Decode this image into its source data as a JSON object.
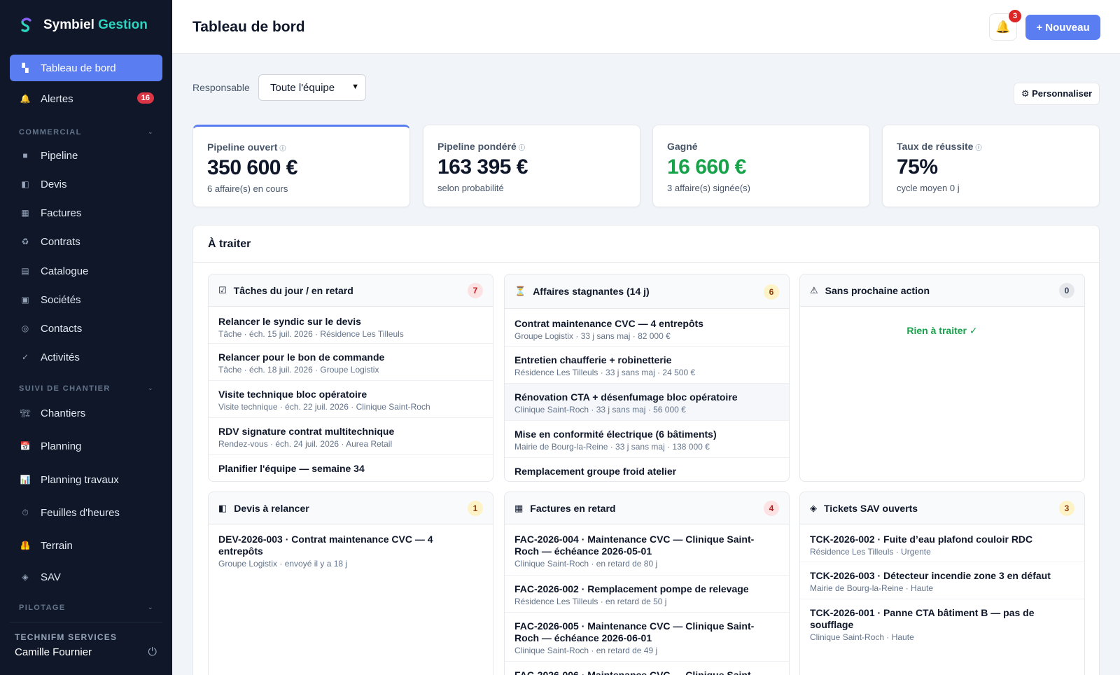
{
  "brand": {
    "name_main": "Symbiel",
    "name_accent": "Gestion"
  },
  "sidebar": {
    "top": [
      {
        "label": "Tableau de bord",
        "icon": "▚"
      },
      {
        "label": "Alertes",
        "icon": "🔔",
        "badge": "16"
      }
    ],
    "sections": [
      {
        "title": "COMMERCIAL",
        "items": [
          {
            "label": "Pipeline",
            "icon": "■"
          },
          {
            "label": "Devis",
            "icon": "◧"
          },
          {
            "label": "Factures",
            "icon": "▦"
          },
          {
            "label": "Contrats",
            "icon": "♻"
          },
          {
            "label": "Catalogue",
            "icon": "▤"
          },
          {
            "label": "Sociétés",
            "icon": "▣"
          },
          {
            "label": "Contacts",
            "icon": "◎"
          },
          {
            "label": "Activités",
            "icon": "✓"
          }
        ]
      },
      {
        "title": "SUIVI DE CHANTIER",
        "items": [
          {
            "label": "Chantiers",
            "icon": "🏗"
          },
          {
            "label": "Planning",
            "icon": "📅"
          },
          {
            "label": "Planning travaux",
            "icon": "📊"
          },
          {
            "label": "Feuilles d'heures",
            "icon": "⏱"
          },
          {
            "label": "Terrain",
            "icon": "🦺"
          },
          {
            "label": "SAV",
            "icon": "◈"
          }
        ]
      },
      {
        "title": "PILOTAGE",
        "items": []
      }
    ],
    "footer": {
      "org": "TECHNIFM SERVICES",
      "user": "Camille Fournier"
    }
  },
  "header": {
    "title": "Tableau de bord",
    "notif_count": "3",
    "new_label": "+ Nouveau"
  },
  "filter": {
    "label": "Responsable",
    "selected": "Toute l'équipe",
    "customize_label": "⚙ Personnaliser"
  },
  "kpis": [
    {
      "label": "Pipeline ouvert",
      "value": "350 600 €",
      "sub": "6 affaire(s) en cours",
      "info": "ⓘ"
    },
    {
      "label": "Pipeline pondéré",
      "value": "163 395 €",
      "sub": "selon probabilité",
      "info": "ⓘ"
    },
    {
      "label": "Gagné",
      "value": "16 660 €",
      "sub": "3 affaire(s) signée(s)",
      "info": ""
    },
    {
      "label": "Taux de réussite",
      "value": "75%",
      "sub": "cycle moyen 0 j",
      "info": "ⓘ"
    }
  ],
  "todo": {
    "title": "À traiter",
    "cards": [
      {
        "icon": "☑",
        "title": "Tâches du jour / en retard",
        "count": "7",
        "rows": [
          {
            "t": "Relancer le syndic sur le devis",
            "s": "Tâche · éch. 15 juil. 2026 · Résidence Les Tilleuls"
          },
          {
            "t": "Relancer pour le bon de commande",
            "s": "Tâche · éch. 18 juil. 2026 · Groupe Logistix"
          },
          {
            "t": "Visite technique bloc opératoire",
            "s": "Visite technique · éch. 22 juil. 2026 · Clinique Saint-Roch"
          },
          {
            "t": "RDV signature contrat multitechnique",
            "s": "Rendez-vous · éch. 24 juil. 2026 · Aurea Retail"
          },
          {
            "t": "Planifier l'équipe — semaine 34",
            "s": ""
          }
        ]
      },
      {
        "icon": "⏳",
        "title": "Affaires stagnantes (14 j)",
        "count": "6",
        "rows": [
          {
            "t": "Contrat maintenance CVC — 4 entrepôts",
            "s": "Groupe Logistix · 33 j sans maj · 82 000 €"
          },
          {
            "t": "Entretien chaufferie + robinetterie",
            "s": "Résidence Les Tilleuls · 33 j sans maj · 24 500 €"
          },
          {
            "t": "Rénovation CTA + désenfumage bloc opératoire",
            "s": "Clinique Saint-Roch · 33 j sans maj · 56 000 €"
          },
          {
            "t": "Mise en conformité électrique (6 bâtiments)",
            "s": "Mairie de Bourg-la-Reine · 33 j sans maj · 138 000 €"
          },
          {
            "t": "Remplacement groupe froid atelier",
            "s": ""
          }
        ]
      },
      {
        "icon": "⚠",
        "title": "Sans prochaine action",
        "count": "0",
        "empty": "Rien à traiter ✓"
      },
      {
        "icon": "◧",
        "title": "Devis à relancer",
        "count": "1",
        "rows": [
          {
            "t": "DEV-2026-003 · Contrat maintenance CVC — 4 entrepôts",
            "s": "Groupe Logistix · envoyé il y a 18 j"
          }
        ]
      },
      {
        "icon": "▦",
        "title": "Factures en retard",
        "count": "4",
        "rows": [
          {
            "t": "FAC-2026-004 · Maintenance CVC — Clinique Saint-Roch — échéance 2026-05-01",
            "s": "Clinique Saint-Roch · en retard de 80 j"
          },
          {
            "t": "FAC-2026-002 · Remplacement pompe de relevage",
            "s": "Résidence Les Tilleuls · en retard de 50 j"
          },
          {
            "t": "FAC-2026-005 · Maintenance CVC — Clinique Saint-Roch — échéance 2026-06-01",
            "s": "Clinique Saint-Roch · en retard de 49 j"
          },
          {
            "t": "FAC-2026-006 · Maintenance CVC — Clinique Saint-",
            "s": ""
          }
        ]
      },
      {
        "icon": "◈",
        "title": "Tickets SAV ouverts",
        "count": "3",
        "rows": [
          {
            "t": "TCK-2026-002 · Fuite d’eau plafond couloir RDC",
            "s": "Résidence Les Tilleuls · Urgente"
          },
          {
            "t": "TCK-2026-003 · Détecteur incendie zone 3 en défaut",
            "s": "Mairie de Bourg-la-Reine · Haute"
          },
          {
            "t": "TCK-2026-001 · Panne CTA bâtiment B — pas de soufflage",
            "s": "Clinique Saint-Roch · Haute"
          }
        ]
      }
    ]
  }
}
